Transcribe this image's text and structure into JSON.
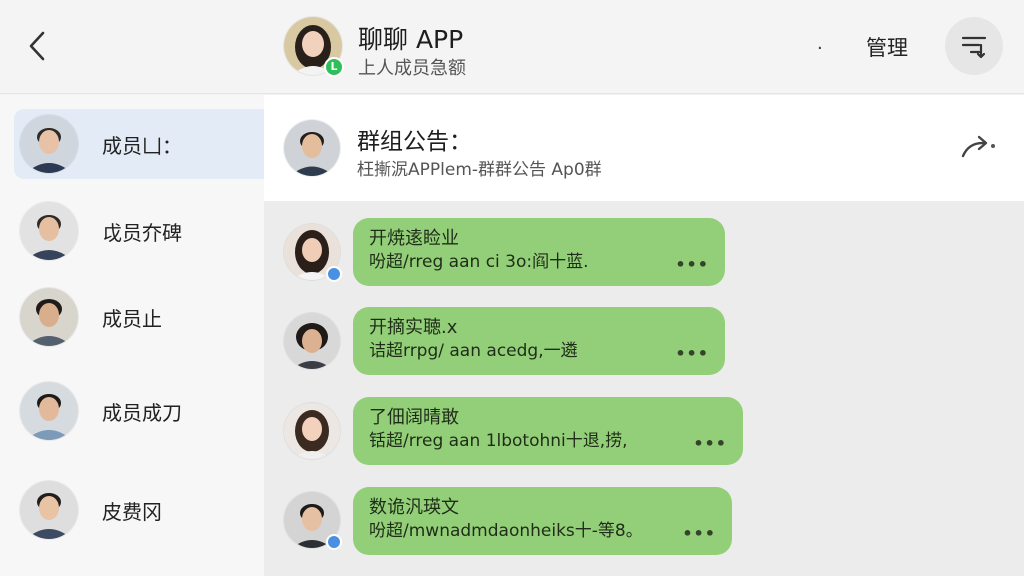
{
  "header": {
    "back_icon": "chevron-left-icon",
    "title": "聊聊 APP",
    "subtitle": "上人成员急额",
    "dot": "·",
    "manage_label": "管理",
    "menu_icon": "list-menu-icon",
    "online_badge": "L"
  },
  "sidebar": {
    "items": [
      {
        "label": "成员凵："
      },
      {
        "label": "戉员夰碑"
      },
      {
        "label": "成员止"
      },
      {
        "label": "成员成刀"
      },
      {
        "label": "皮费冈"
      }
    ]
  },
  "announcement": {
    "title": "群组公告：",
    "text": "枉摲泦APPlem-群群公告 Ap0群",
    "share_icon": "share-arrow-icon"
  },
  "messages": [
    {
      "title": "开焼逺睑业",
      "body": "吩超/rreg aan ci 3o:阎十蓝.",
      "more": "•••"
    },
    {
      "title": "开摘实聴.x",
      "body": "诘超rrpg/ aan acedg,一遴",
      "more": "•••"
    },
    {
      "title": "了佃阔晴敢",
      "body": "铦超/rreg aan 1lbotohni十退,捞,",
      "more": "•••"
    },
    {
      "title": "数诡汎瑛文",
      "body": "吩超/mwnadmdaonheiks十-等8。",
      "more": "•••"
    }
  ],
  "colors": {
    "bubble": "#93cf78",
    "active_member": "#e3ebf7",
    "online": "#2fbf5a",
    "verified": "#4a90e2"
  }
}
